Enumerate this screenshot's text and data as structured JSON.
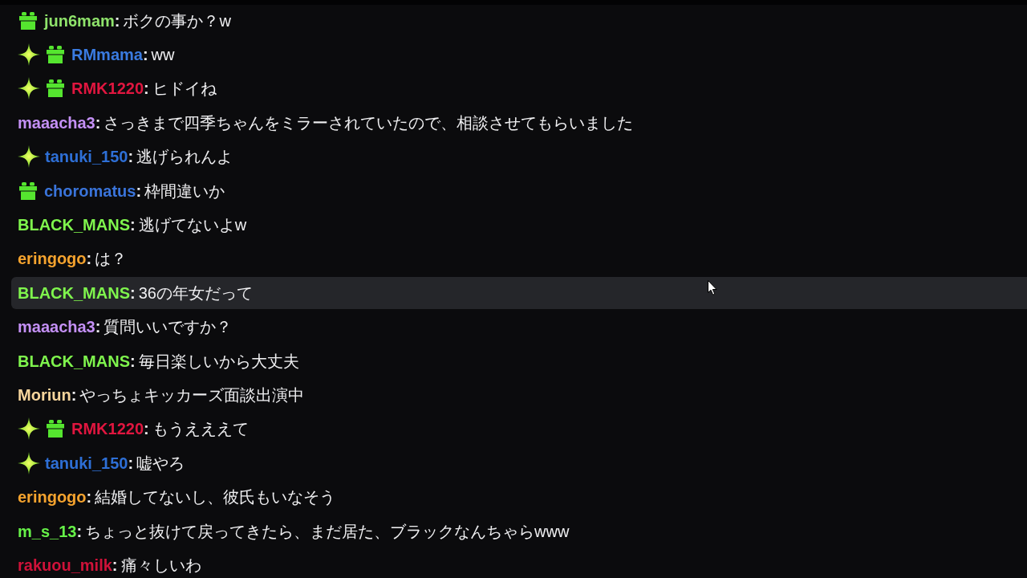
{
  "chat": {
    "messages": [
      {
        "badges": [
          {
            "kind": "gift"
          }
        ],
        "user": "jun6mam",
        "color": "#8fe36b",
        "separator": ":",
        "text": "ボクの事か？w",
        "highlighted": false
      },
      {
        "badges": [
          {
            "kind": "sparkle"
          },
          {
            "kind": "gift"
          }
        ],
        "user": "RMmama",
        "color": "#3a7be0",
        "separator": ":",
        "text": "ww",
        "highlighted": false
      },
      {
        "badges": [
          {
            "kind": "sparkle"
          },
          {
            "kind": "gift"
          }
        ],
        "user": "RMK1220",
        "color": "#e0163f",
        "separator": ":",
        "text": "ヒドイね",
        "highlighted": false
      },
      {
        "user": "maaacha3",
        "color": "#c490f5",
        "separator": ":",
        "text": "さっきまで四季ちゃんをミラーされていたので、相談させてもらいました",
        "highlighted": false
      },
      {
        "badges": [
          {
            "kind": "sparkle"
          }
        ],
        "user": "tanuki_150",
        "color": "#2e6fd6",
        "separator": ":",
        "text": "逃げられんよ",
        "highlighted": false
      },
      {
        "badges": [
          {
            "kind": "gift"
          }
        ],
        "user": "choromatus",
        "color": "#3a74da",
        "separator": ":",
        "text": "枠間違いか",
        "highlighted": false
      },
      {
        "user": "BLACK_MANS",
        "color": "#7ff54d",
        "separator": ":",
        "text": "逃げてないよw",
        "highlighted": false
      },
      {
        "user": "eringogo",
        "color": "#f5a32e",
        "separator": ":",
        "text": "は？",
        "highlighted": false
      },
      {
        "user": "BLACK_MANS",
        "color": "#7ff54d",
        "separator": ":",
        "text": "36の年女だって",
        "highlighted": true
      },
      {
        "user": "maaacha3",
        "color": "#c490f5",
        "separator": ":",
        "text": "質問いいですか？",
        "highlighted": false
      },
      {
        "user": "BLACK_MANS",
        "color": "#7ff54d",
        "separator": ":",
        "text": "毎日楽しいから大丈夫",
        "highlighted": false
      },
      {
        "user": "Moriun",
        "color": "#f6d59c",
        "separator": ":",
        "text": "やっちょキッカーズ面談出演中",
        "highlighted": false
      },
      {
        "badges": [
          {
            "kind": "sparkle"
          },
          {
            "kind": "gift"
          }
        ],
        "user": "RMK1220",
        "color": "#e0163f",
        "separator": ":",
        "text": "もうえええて",
        "highlighted": false
      },
      {
        "badges": [
          {
            "kind": "sparkle"
          }
        ],
        "user": "tanuki_150",
        "color": "#2e6fd6",
        "separator": ":",
        "text": "嘘やろ",
        "highlighted": false
      },
      {
        "user": "eringogo",
        "color": "#f5a32e",
        "separator": ":",
        "text": "結婚してないし、彼氏もいなそう",
        "highlighted": false
      },
      {
        "user": "m_s_13",
        "color": "#66f148",
        "separator": ":",
        "text": "ちょっと抜けて戻ってきたら、まだ居た、ブラックなんちゃらwww",
        "highlighted": false
      },
      {
        "user": "rakuou_milk",
        "color": "#cf1239",
        "separator": ":",
        "text": "痛々しいわ",
        "highlighted": false
      }
    ]
  }
}
